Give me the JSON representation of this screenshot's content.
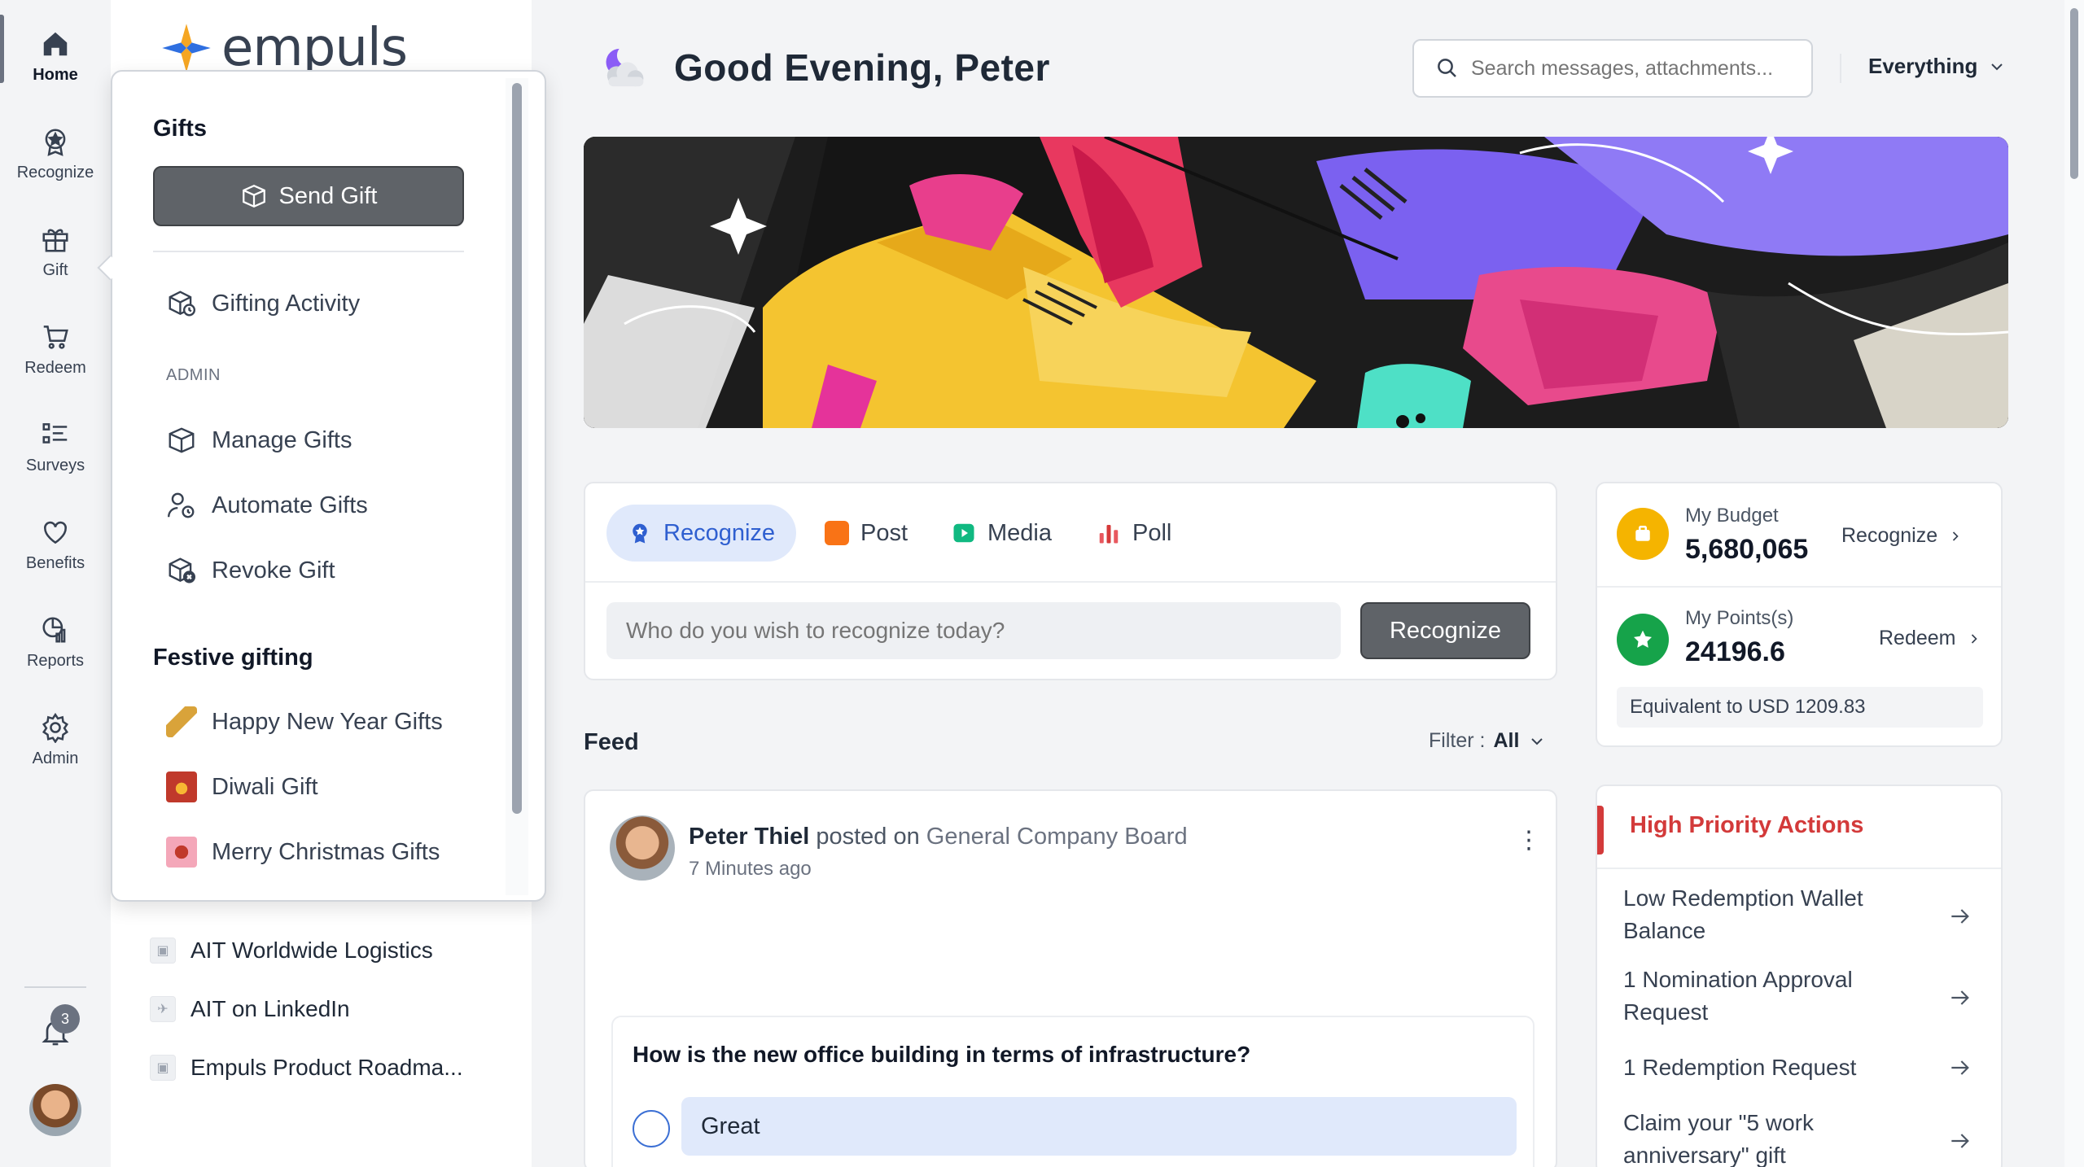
{
  "rail": {
    "items": [
      {
        "label": "Home",
        "icon": "home-icon"
      },
      {
        "label": "Recognize",
        "icon": "award-icon"
      },
      {
        "label": "Gift",
        "icon": "gift-icon"
      },
      {
        "label": "Redeem",
        "icon": "cart-icon"
      },
      {
        "label": "Surveys",
        "icon": "list-icon"
      },
      {
        "label": "Benefits",
        "icon": "heart-icon"
      },
      {
        "label": "Reports",
        "icon": "reports-icon"
      },
      {
        "label": "Admin",
        "icon": "gear-icon"
      }
    ],
    "notifications_count": "3"
  },
  "brand": {
    "name": "empuls"
  },
  "channels": [
    {
      "label": "AIT Worldwide Logistics"
    },
    {
      "label": "AIT on LinkedIn"
    },
    {
      "label": "Empuls Product Roadma..."
    }
  ],
  "gift_menu": {
    "title": "Gifts",
    "send_gift": "Send Gift",
    "activity": "Gifting Activity",
    "admin_section": "ADMIN",
    "admin_items": [
      "Manage Gifts",
      "Automate Gifts",
      "Revoke Gift"
    ],
    "festive_heading": "Festive gifting",
    "festive_items": [
      "Happy New Year Gifts",
      "Diwali Gift",
      "Merry Christmas Gifts"
    ]
  },
  "header": {
    "greeting": "Good Evening, Peter",
    "search_placeholder": "Search messages, attachments...",
    "scope": "Everything"
  },
  "composer": {
    "tabs": [
      "Recognize",
      "Post",
      "Media",
      "Poll"
    ],
    "active_tab": "Recognize",
    "input_placeholder": "Who do you wish to recognize today?",
    "button": "Recognize"
  },
  "feed": {
    "title": "Feed",
    "filter_label": "Filter :",
    "filter_value": "All",
    "post": {
      "author": "Peter Thiel",
      "action": "posted on",
      "board": "General Company Board",
      "time": "7 Minutes ago",
      "poll_question": "How is the new office building in terms of infrastructure?",
      "options": [
        "Great"
      ]
    }
  },
  "wallet": {
    "budget_label": "My Budget",
    "budget_value": "5,680,065",
    "budget_link": "Recognize",
    "points_label": "My Points(s)",
    "points_value": "24196.6",
    "points_link": "Redeem",
    "equivalent": "Equivalent to USD 1209.83"
  },
  "actions": {
    "title": "High Priority Actions",
    "items": [
      "Low Redemption Wallet Balance",
      "1 Nomination Approval Request",
      "1 Redemption Request",
      "Claim your \"5 work anniversary\" gift"
    ]
  },
  "colors": {
    "accent_blue": "#2f5fd0",
    "danger": "#d33a3a",
    "budget_coin": "#f5b400",
    "points_coin": "#16a34a"
  }
}
